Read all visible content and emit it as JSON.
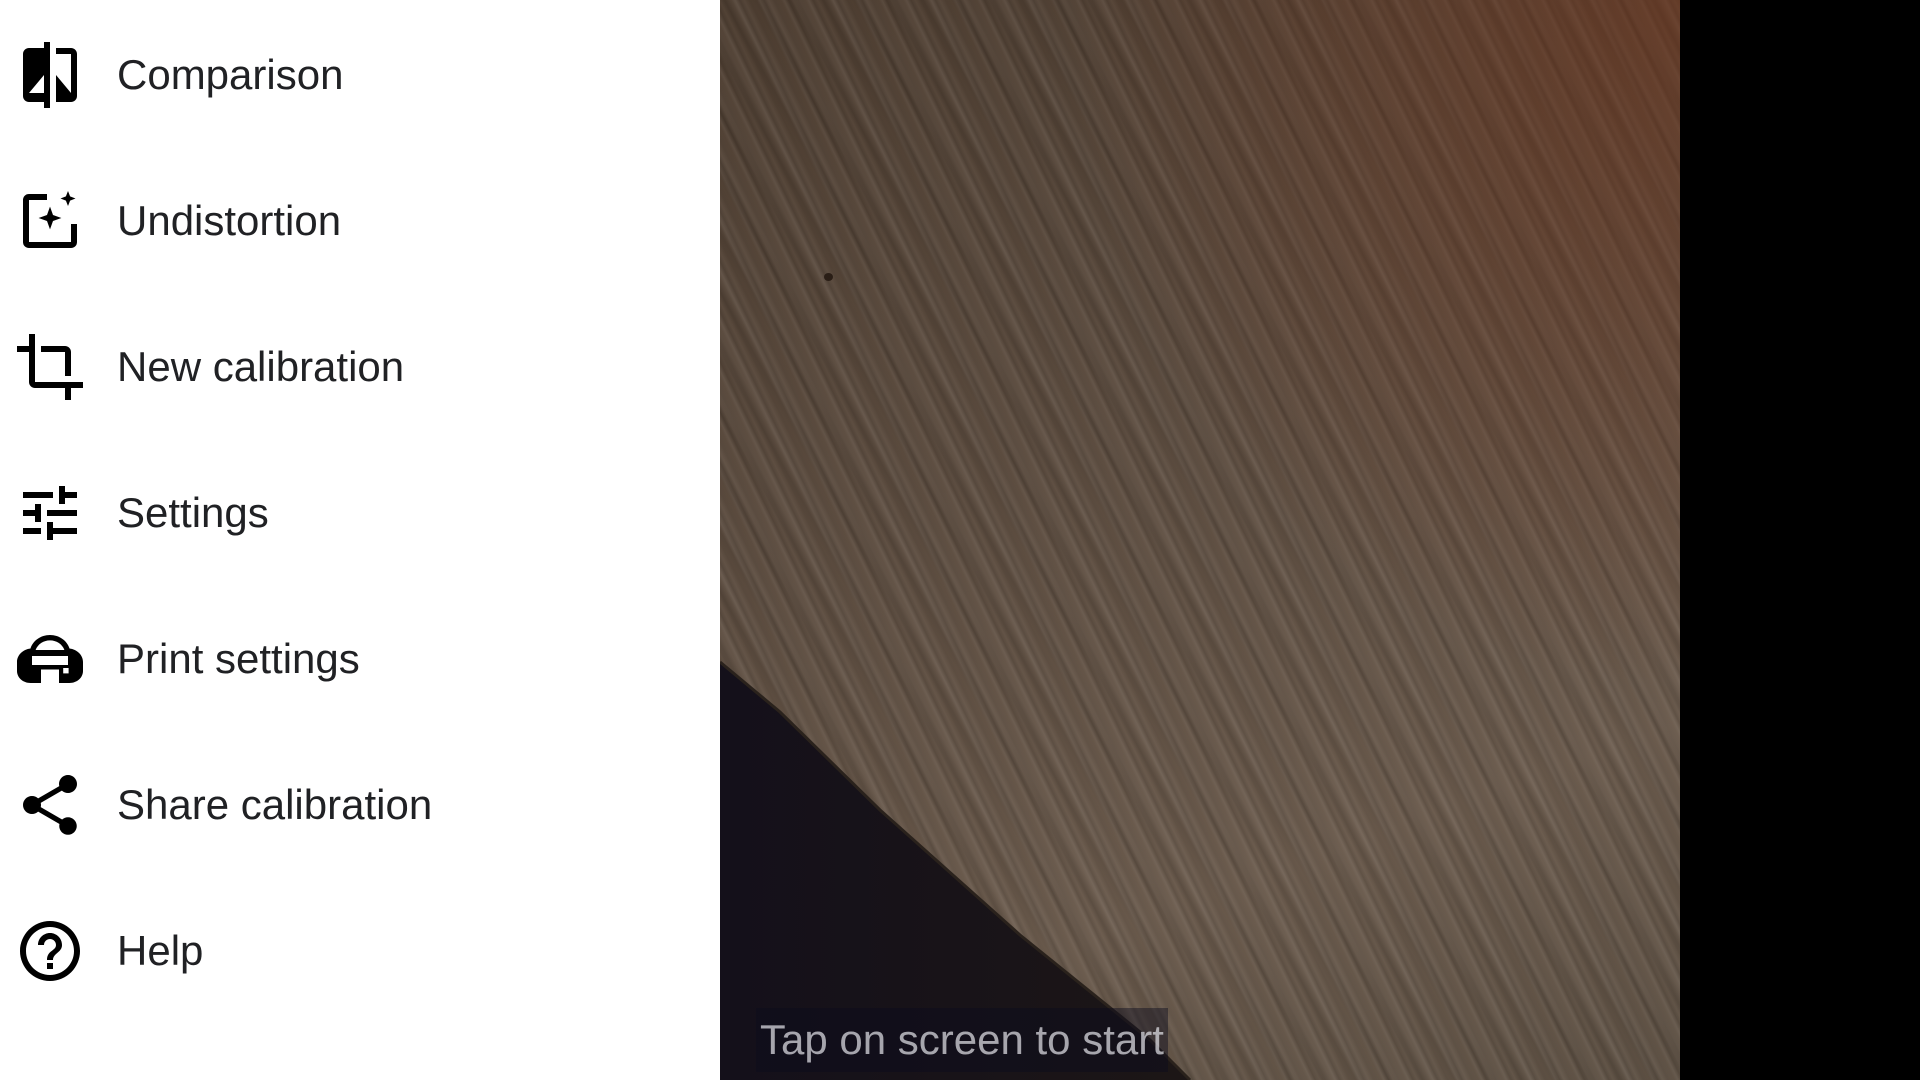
{
  "drawer": {
    "items": [
      {
        "label": "Comparison",
        "icon": "compare-icon"
      },
      {
        "label": "Undistortion",
        "icon": "auto-fix-image-icon"
      },
      {
        "label": "New calibration",
        "icon": "crop-rotate-icon"
      },
      {
        "label": "Settings",
        "icon": "tune-sliders-icon"
      },
      {
        "label": "Print settings",
        "icon": "print-cloud-icon"
      },
      {
        "label": "Share calibration",
        "icon": "share-icon"
      },
      {
        "label": "Help",
        "icon": "help-circle-icon"
      }
    ]
  },
  "camera": {
    "hint": "Tap on screen to start"
  },
  "colors": {
    "drawer_background": "#ffffff",
    "label_text": "#202124",
    "icon": "#000000",
    "letterbox": "#000000"
  }
}
